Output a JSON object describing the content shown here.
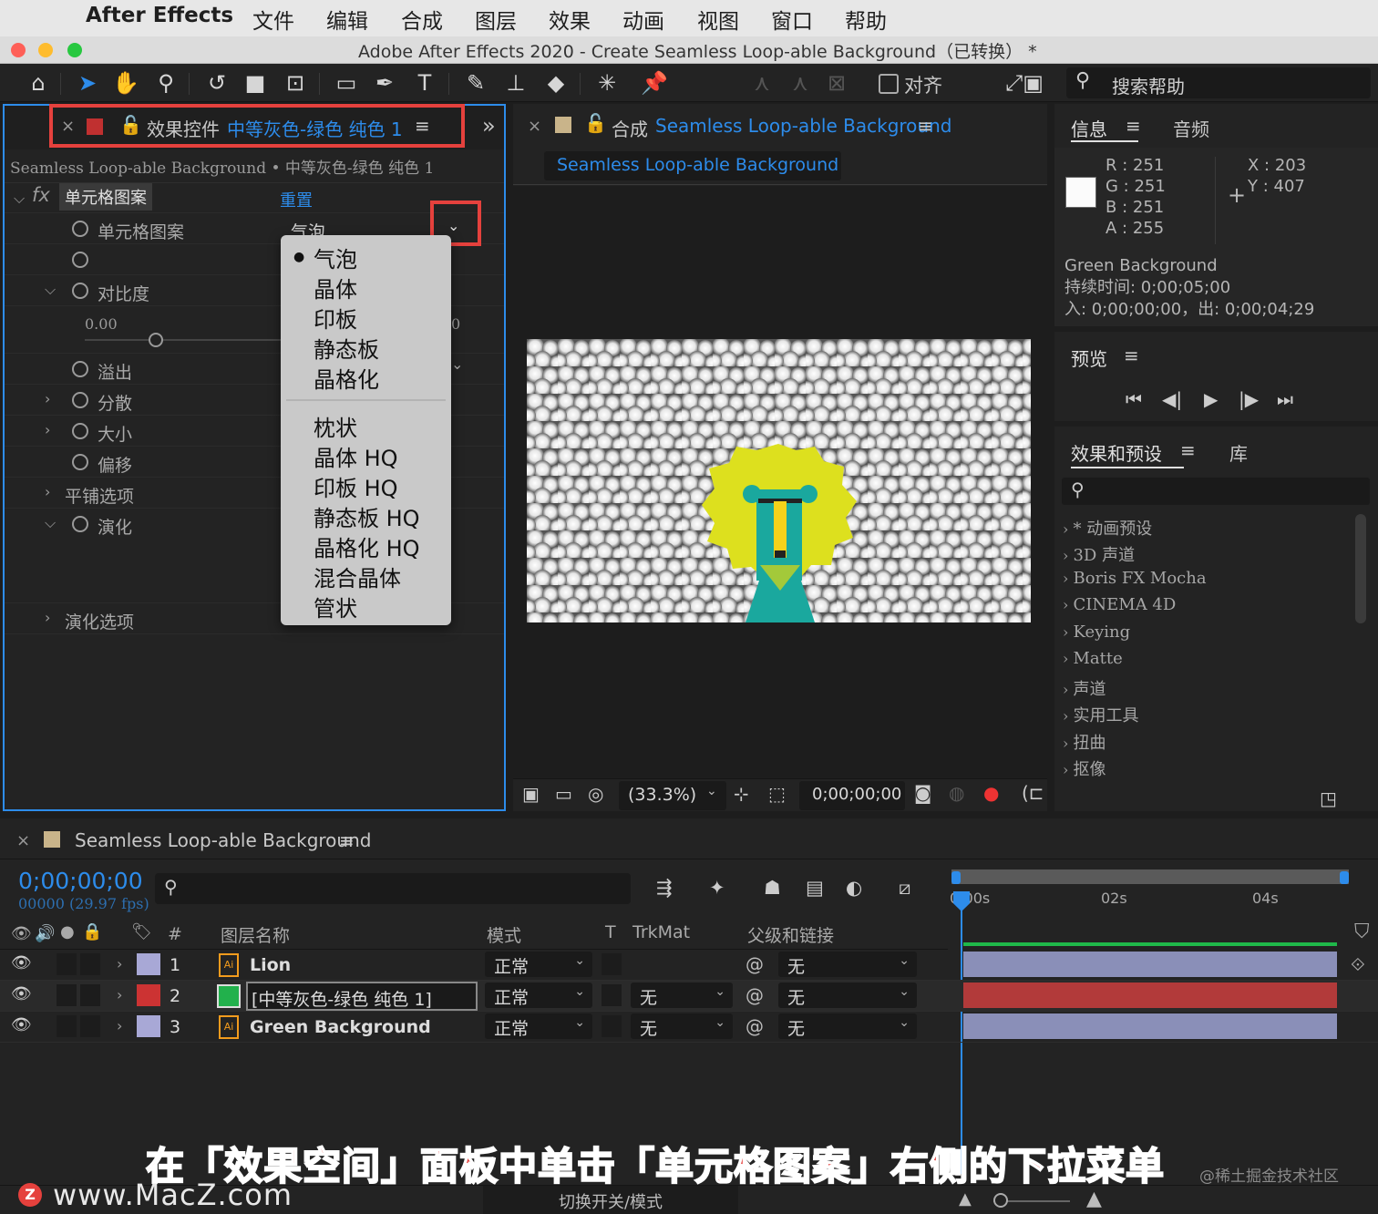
{
  "menubar": {
    "app": "After Effects",
    "items": [
      "文件",
      "编辑",
      "合成",
      "图层",
      "效果",
      "动画",
      "视图",
      "窗口",
      "帮助"
    ]
  },
  "window": {
    "title": "Adobe After Effects 2020 - Create Seamless Loop-able Background（已转换） *"
  },
  "toolbar": {
    "align_label": "对齐",
    "search_help": "搜索帮助"
  },
  "effects_panel": {
    "tab_prefix": "效果控件",
    "tab_layer": "中等灰色-绿色 纯色 1",
    "breadcrumb": "Seamless Loop-able Background • 中等灰色-绿色 纯色 1",
    "effect_name": "单元格图案",
    "reset": "重置",
    "props": {
      "cell_pattern": "单元格图案",
      "cell_value": "气泡",
      "contrast": "对比度",
      "contrast_value": "0.00",
      "contrast_right": "0",
      "overflow": "溢出",
      "disperse": "分散",
      "size": "大小",
      "offset": "偏移",
      "tiling": "平铺选项",
      "evolution": "演化",
      "evolution_opts": "演化选项"
    },
    "dropdown_options": [
      "气泡",
      "晶体",
      "印板",
      "静态板",
      "晶格化",
      "枕状",
      "晶体 HQ",
      "印板 HQ",
      "静态板 HQ",
      "晶格化 HQ",
      "混合晶体",
      "管状"
    ],
    "dropdown_selected": "气泡"
  },
  "comp_panel": {
    "tab_prefix": "合成",
    "tab_name": "Seamless Loop-able Background",
    "subtab": "Seamless Loop-able Background",
    "zoom": "(33.3%)",
    "timecode": "0;00;00;00"
  },
  "info_panel": {
    "tab": "信息",
    "tab2": "音频",
    "r": "251",
    "g": "251",
    "b": "251",
    "a": "255",
    "x": "203",
    "y": "407",
    "r_label": "R :",
    "g_label": "G :",
    "b_label": "B :",
    "a_label": "A :",
    "x_label": "X :",
    "y_label": "Y :",
    "layer": "Green Background",
    "duration": "持续时间: 0;00;05;00",
    "inout": "入: 0;00;00;00，出: 0;00;04;29"
  },
  "preview_panel": {
    "tab": "预览"
  },
  "fx_presets": {
    "tab": "效果和预设",
    "tab2": "库",
    "items": [
      "* 动画预设",
      "3D 声道",
      "Boris FX Mocha",
      "CINEMA 4D",
      "Keying",
      "Matte",
      "声道",
      "实用工具",
      "扭曲",
      "抠像"
    ]
  },
  "timeline": {
    "tab": "Seamless Loop-able Background",
    "timecode": "0;00;00;00",
    "frames": "00000 (29.97 fps)",
    "headers": {
      "num": "#",
      "name": "图层名称",
      "mode": "模式",
      "t": "T",
      "trkmat": "TrkMat",
      "parent": "父级和链接"
    },
    "ruler": [
      "0:00s",
      "02s",
      "04s"
    ],
    "layers": [
      {
        "num": "1",
        "name": "Lion",
        "mode": "正常",
        "trkmat": "",
        "parent": "无",
        "label_color": "#a8a8d6",
        "bar_color": "#8a8fb8"
      },
      {
        "num": "2",
        "name": "[中等灰色-绿色 纯色 1]",
        "mode": "正常",
        "trkmat": "无",
        "parent": "无",
        "label_color": "#cc3333",
        "bar_color": "#b23a3a"
      },
      {
        "num": "3",
        "name": "Green Background",
        "mode": "正常",
        "trkmat": "无",
        "parent": "无",
        "label_color": "#a8a8d6",
        "bar_color": "#8a8fb8"
      }
    ],
    "toggle_label": "切换开关/模式"
  },
  "overlay": {
    "caption": "在「效果空间」面板中单击「单元格图案」右侧的下拉菜单",
    "watermark_left": "www.MacZ.com",
    "watermark_right": "@稀土掘金技术社区"
  },
  "colors": {
    "accent": "#2d8ceb",
    "highlight": "#e5413d"
  }
}
